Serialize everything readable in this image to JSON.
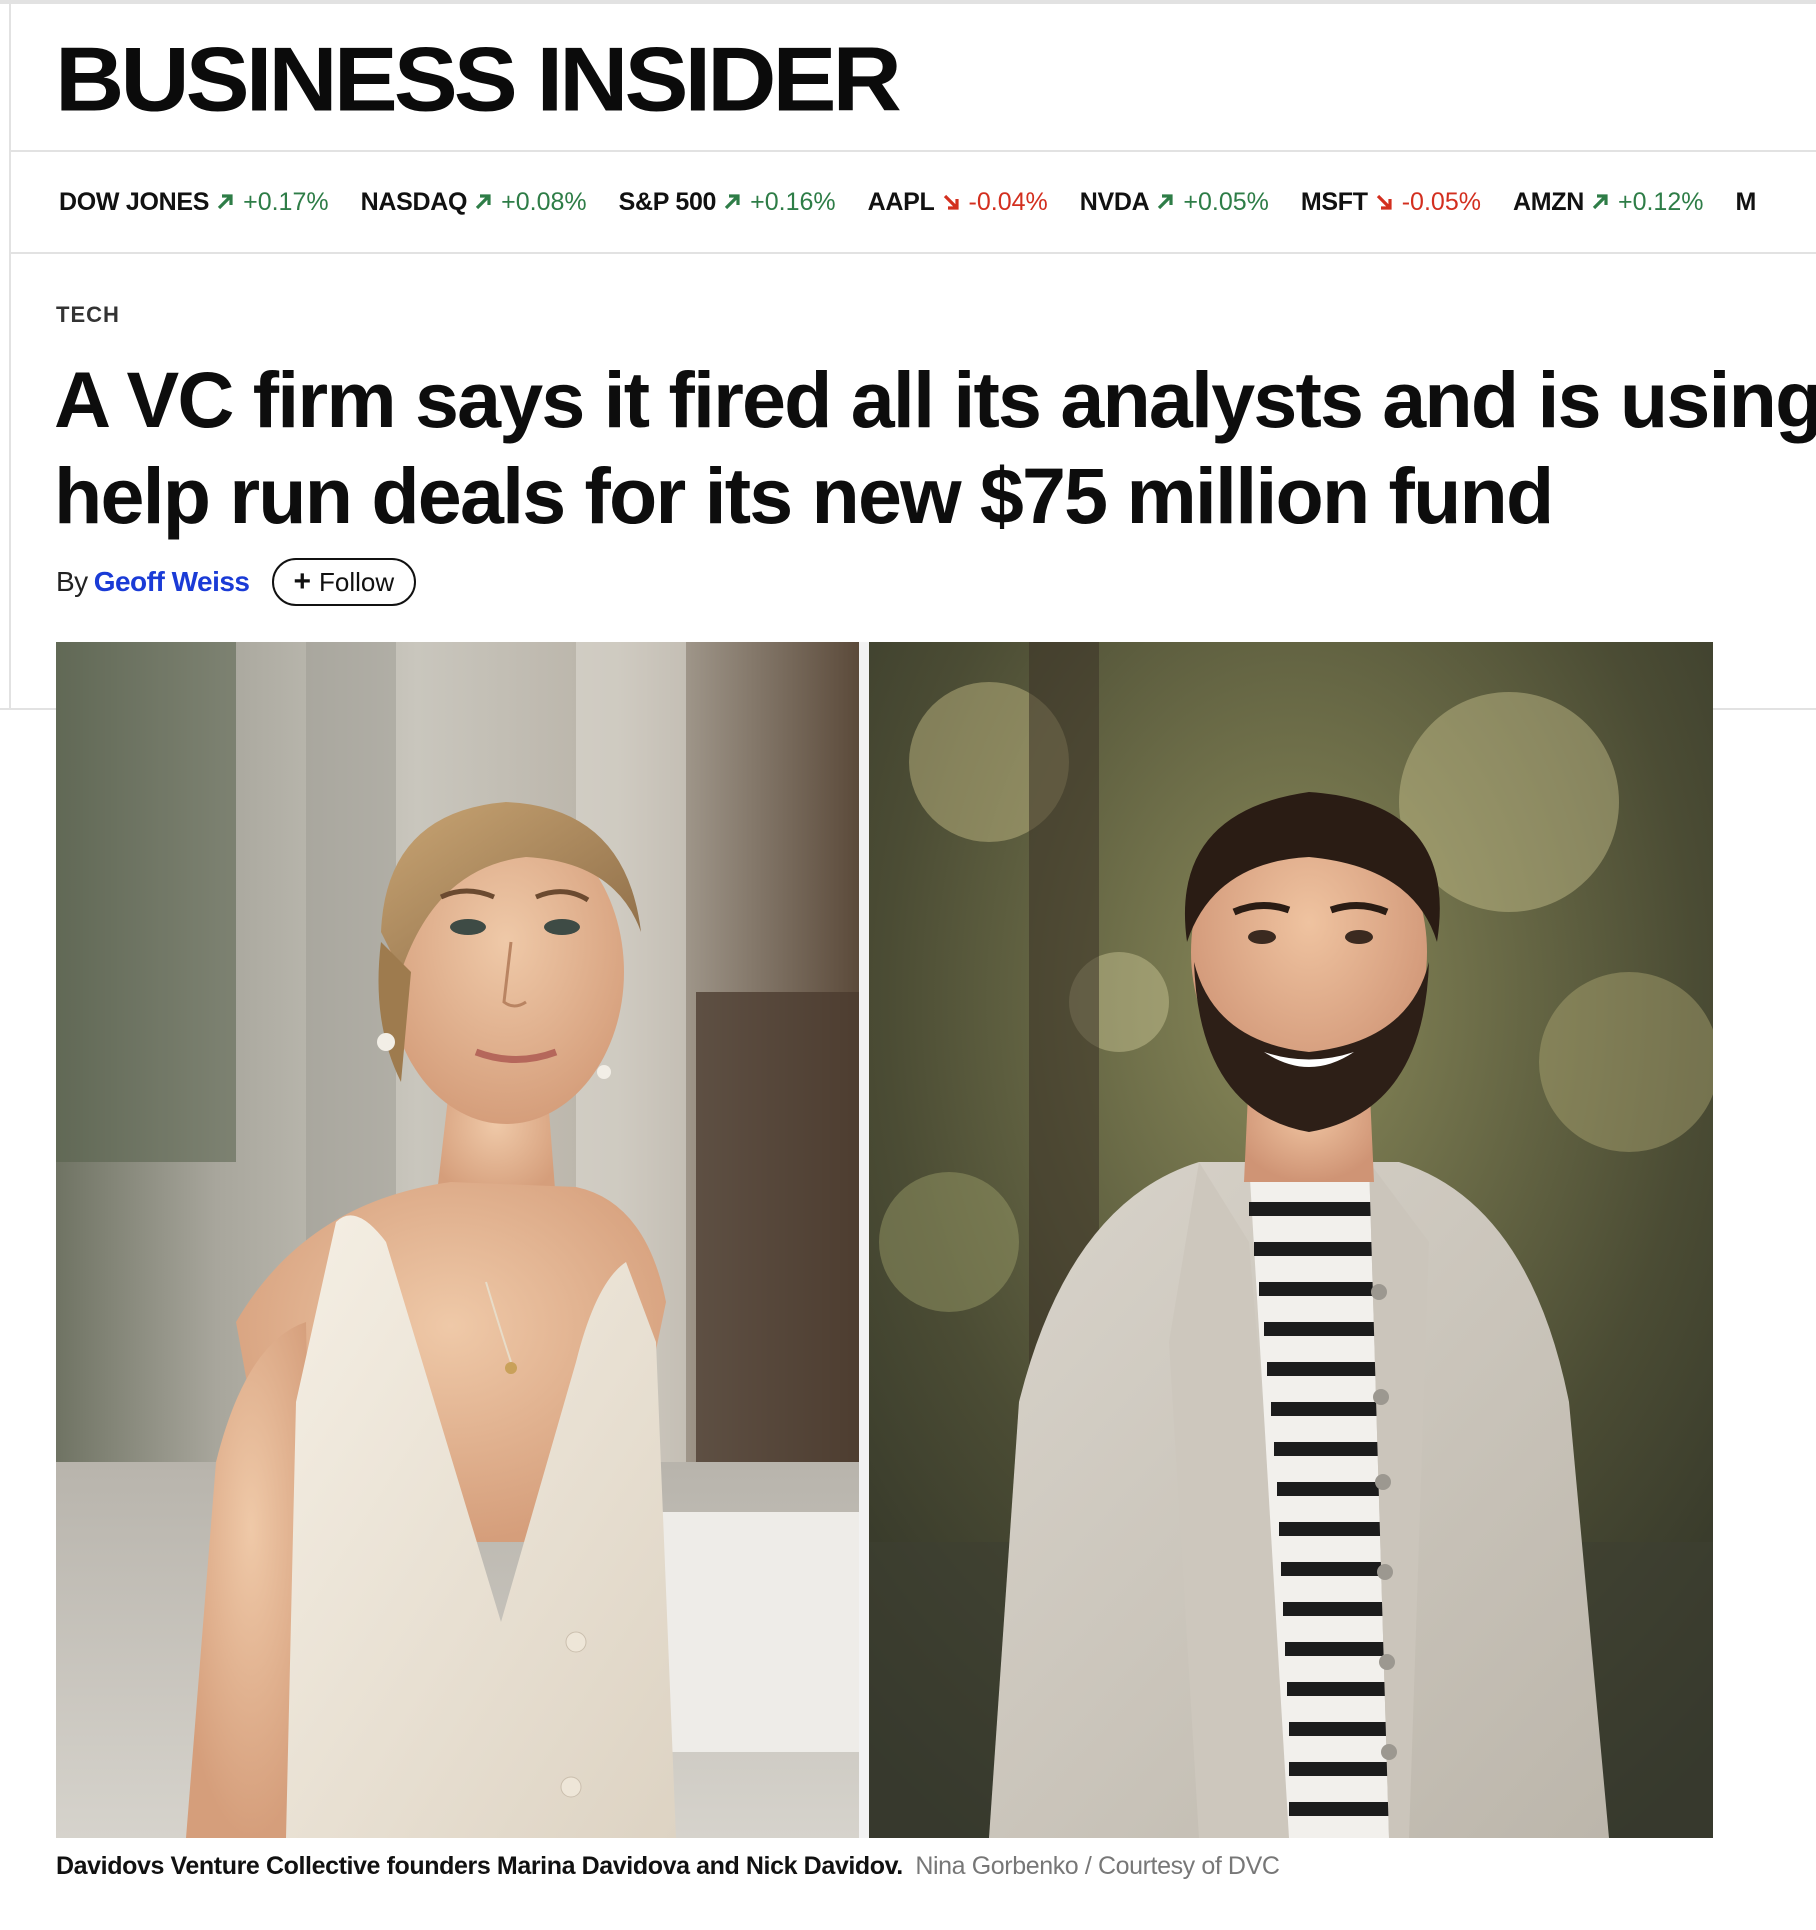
{
  "brand": {
    "logo": "BUSINESS INSIDER"
  },
  "ticker": [
    {
      "name": "DOW JONES",
      "change": "+0.17%",
      "direction": "up"
    },
    {
      "name": "NASDAQ",
      "change": "+0.08%",
      "direction": "up"
    },
    {
      "name": "S&P 500",
      "change": "+0.16%",
      "direction": "up"
    },
    {
      "name": "AAPL",
      "change": "-0.04%",
      "direction": "down"
    },
    {
      "name": "NVDA",
      "change": "+0.05%",
      "direction": "up"
    },
    {
      "name": "MSFT",
      "change": "-0.05%",
      "direction": "down"
    },
    {
      "name": "AMZN",
      "change": "+0.12%",
      "direction": "up"
    },
    {
      "name": "M",
      "change": "",
      "direction": ""
    }
  ],
  "colors": {
    "up": "#2e7d47",
    "down": "#d32f1f",
    "author_link": "#1a3bd6"
  },
  "article": {
    "category": "TECH",
    "headline_line1": "A VC firm says it fired all its analysts and is using",
    "headline_line2": "help run deals for its new $75 million fund",
    "by_label": "By",
    "author": "Geoff Weiss",
    "follow_label": "Follow",
    "caption": "Davidovs Venture Collective founders Marina Davidova and Nick Davidov.",
    "credit": "Nina Gorbenko / Courtesy of DVC"
  },
  "icons": {
    "up": "arrow-up-right-icon",
    "down": "arrow-down-right-icon",
    "follow": "plus-icon"
  }
}
